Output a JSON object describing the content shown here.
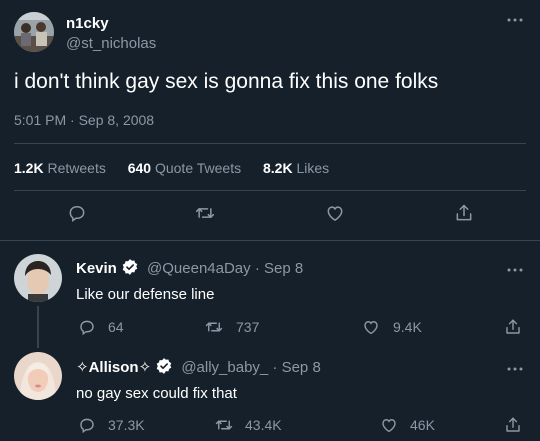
{
  "main_tweet": {
    "display_name": "n1cky",
    "handle": "@st_nicholas",
    "text": "i don't think gay sex is gonna fix this one folks",
    "timestamp": "5:01 PM · Sep 8, 2008",
    "stats": {
      "retweets_count": "1.2K",
      "retweets_label": "Retweets",
      "quotes_count": "640",
      "quotes_label": "Quote Tweets",
      "likes_count": "8.2K",
      "likes_label": "Likes"
    }
  },
  "replies": [
    {
      "display_name": "Kevin",
      "handle_date": "@Queen4aDay · Sep 8",
      "text": "Like our defense line",
      "replies": "64",
      "retweets": "737",
      "likes": "9.4K"
    },
    {
      "display_name": "✧Allison✧",
      "handle_date": "@ally_baby_ · Sep 8",
      "text": "no gay sex could fix that",
      "replies": "37.3K",
      "retweets": "43.4K",
      "likes": "46K"
    }
  ],
  "colors": {
    "background": "#15202b",
    "muted": "#8b98a5",
    "divider": "#38444d",
    "verified": "#ffffff"
  },
  "icons": [
    "more-icon",
    "reply-icon",
    "retweet-icon",
    "like-icon",
    "share-icon",
    "verified-icon"
  ]
}
